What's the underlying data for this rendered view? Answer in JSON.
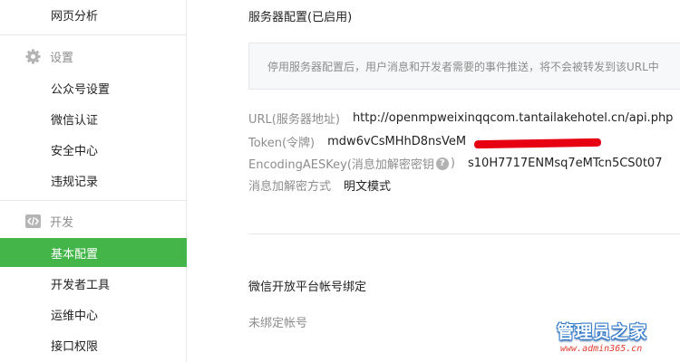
{
  "sidebar": {
    "items_top": [
      {
        "label": "网页分析"
      }
    ],
    "settings_group": {
      "title": "设置",
      "icon": "gear-icon",
      "items": [
        {
          "label": "公众号设置"
        },
        {
          "label": "微信认证"
        },
        {
          "label": "安全中心"
        },
        {
          "label": "违规记录"
        }
      ]
    },
    "dev_group": {
      "title": "开发",
      "icon": "code-icon",
      "items": [
        {
          "label": "基本配置",
          "active": true
        },
        {
          "label": "开发者工具"
        },
        {
          "label": "运维中心"
        },
        {
          "label": "接口权限"
        }
      ]
    }
  },
  "main": {
    "server_config_title": "服务器配置(已启用)",
    "notice": "停用服务器配置后，用户消息和开发者需要的事件推送，将不会被转发到该URL中",
    "fields": {
      "url": {
        "label": "URL(服务器地址)",
        "value": "http://openmpweixinqqcom.tantailakehotel.cn/api.php"
      },
      "token": {
        "label": "Token(令牌)",
        "value": "mdw6vCsMHhD8nsVeM"
      },
      "aeskey": {
        "label": "EncodingAESKey(消息加解密密钥",
        "help": "?",
        "value": "s10H7717ENMsq7eMTcn5CS0t07"
      },
      "encrypt_mode": {
        "label": "消息加解密方式",
        "value": "明文模式"
      }
    },
    "open_platform_title": "微信开放平台帐号绑定",
    "open_platform_status": "未绑定帐号"
  },
  "watermark": {
    "title": "管理员之家",
    "url": "www.admin365.cn"
  },
  "colors": {
    "accent_green": "#44b549",
    "muted_text": "#8d8d8d",
    "border": "#e7e7eb",
    "redaction": "#e60012"
  }
}
